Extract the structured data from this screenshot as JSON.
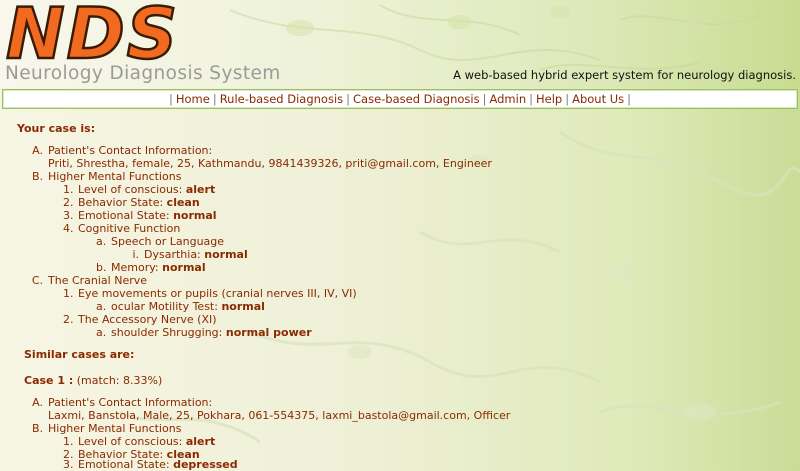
{
  "header": {
    "logo": "NDS",
    "subtitle": "Neurology Diagnosis System",
    "tagline": "A web-based hybrid expert system for neurology diagnosis."
  },
  "nav": {
    "items": [
      "Home",
      "Rule-based Diagnosis",
      "Case-based Diagnosis",
      "Admin",
      "Help",
      "About Us"
    ]
  },
  "case": {
    "heading": "Your case is:",
    "sectionA": "Patient's Contact Information:",
    "contact": "Priti, Shrestha, female, 25, Kathmandu, 9841439326, priti@gmail.com, Engineer",
    "sectionB": "Higher Mental Functions",
    "b1_label": "Level of conscious: ",
    "b1_value": "alert",
    "b2_label": "Behavior State: ",
    "b2_value": "clean",
    "b3_label": "Emotional State: ",
    "b3_value": "normal",
    "b4_label": "Cognitive Function",
    "b4a_label": "Speech or Language",
    "b4ai_label": "Dysarthia: ",
    "b4ai_value": "normal",
    "b4b_label": "Memory: ",
    "b4b_value": "normal",
    "sectionC": "The Cranial Nerve",
    "c1_label": "Eye movements or pupils (cranial nerves III, IV, VI)",
    "c1a_label": "ocular Motility Test: ",
    "c1a_value": "normal",
    "c2_label": "The Accessory Nerve (XI)",
    "c2a_label": "shoulder Shrugging: ",
    "c2a_value": "normal power"
  },
  "similar": {
    "heading": "Similar cases are:",
    "case1_title": "Case 1 :",
    "case1_match": " (match: 8.33%)",
    "sectionA": "Patient's Contact Information:",
    "contact": "Laxmi, Banstola, Male, 25, Pokhara, 061-554375, laxmi_bastola@gmail.com, Officer",
    "sectionB": "Higher Mental Functions",
    "b1_label": "Level of conscious: ",
    "b1_value": "alert",
    "b2_label": "Behavior State: ",
    "b2_value": "clean",
    "b3_label": "Emotional State: ",
    "b3_value": "depressed"
  },
  "markers": {
    "A": "A.",
    "B": "B.",
    "C": "C.",
    "n1": "1.",
    "n2": "2.",
    "n3": "3.",
    "n4": "4.",
    "a": "a.",
    "b": "b.",
    "i": "i."
  },
  "colors": {
    "text": "#8a2a00",
    "logo_fill": "#f26a1f",
    "nav_border": "#9bbf5a"
  }
}
